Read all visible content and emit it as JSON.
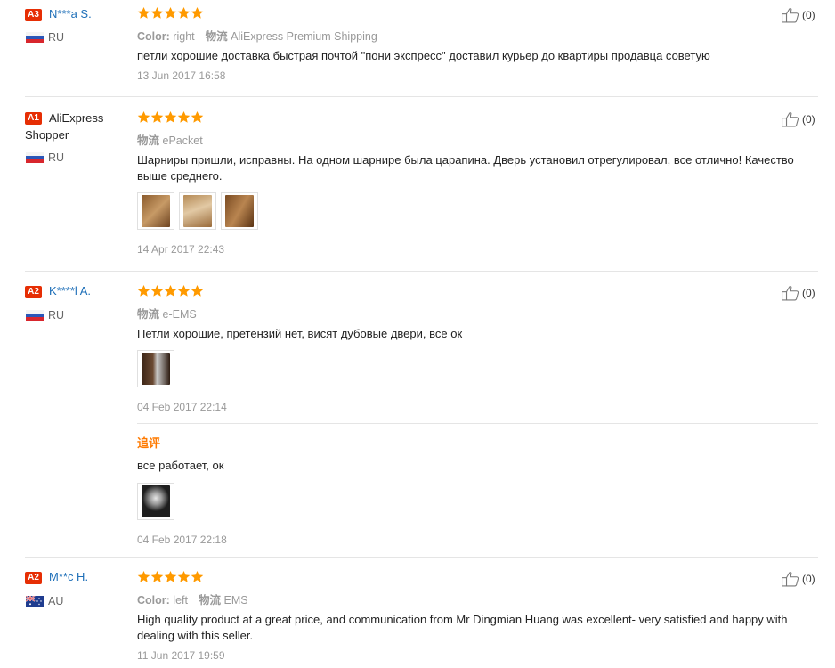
{
  "reviews": [
    {
      "badge": "A3",
      "name": "N***a S.",
      "country": "RU",
      "meta": {
        "color_label": "Color:",
        "color_value": "right",
        "logistics_label": "物流",
        "logistics_value": "AliExpress Premium Shipping"
      },
      "text": "петли хорошие доставка быстрая почтой \"пони экспресс\" доставил курьер до квартиры продавца советую",
      "date": "13 Jun 2017 16:58",
      "likes": "(0)"
    },
    {
      "badge": "A1",
      "name_line1": "AliExpress",
      "name_line2": "Shopper",
      "country": "RU",
      "meta": {
        "logistics_label": "物流",
        "logistics_value": "ePacket"
      },
      "text_line1": "Шарниры пришли, исправны. На одном шарнире была царапина. Дверь установил отрегулировал, все отлично! Качество",
      "text_line2": "выше среднего.",
      "date": "14 Apr 2017 22:43",
      "likes": "(0)"
    },
    {
      "badge": "A2",
      "name": "K****l A.",
      "country": "RU",
      "meta": {
        "logistics_label": "物流",
        "logistics_value": "e-EMS"
      },
      "text": "Петли хорошие, претензий нет, висят дубовые двери, все ок",
      "date": "04 Feb 2017 22:14",
      "additional": {
        "title": "追评",
        "text": "все работает, ок",
        "date": "04 Feb 2017 22:18"
      },
      "likes": "(0)"
    },
    {
      "badge": "A2",
      "name": "M**c H.",
      "country": "AU",
      "meta": {
        "color_label": "Color:",
        "color_value": "left",
        "logistics_label": "物流",
        "logistics_value": "EMS"
      },
      "text_line1": "High quality product at a great price, and communication from Mr Dingmian Huang was excellent- very satisfied and happy with",
      "text_line2": "dealing with this seller.",
      "date": "11 Jun 2017 19:59",
      "likes": "(0)"
    }
  ],
  "icons": {
    "star": "star-icon",
    "like": "thumbs-up-icon",
    "flag_ru": "russia-flag-icon",
    "flag_au": "australia-flag-icon"
  },
  "colors": {
    "badge": "#e62e04",
    "star": "#ff9a00",
    "link": "#1e6fb8",
    "additional_title": "#ff7a00"
  }
}
